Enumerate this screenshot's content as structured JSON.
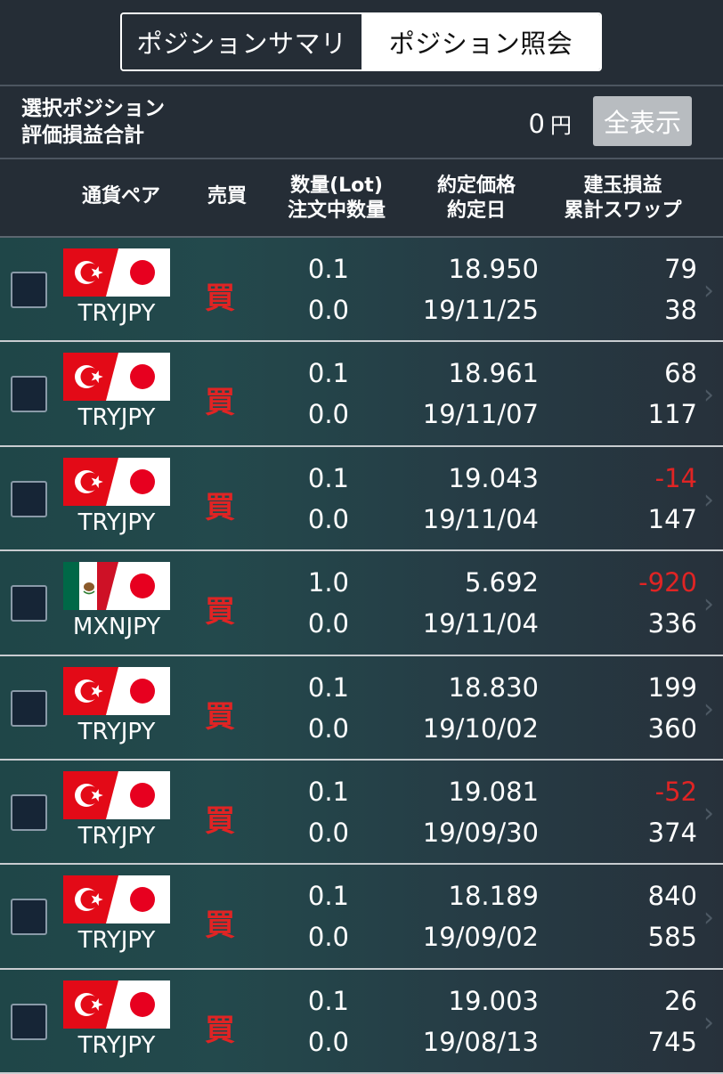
{
  "tabs": [
    {
      "label": "ポジションサマリ",
      "active": false
    },
    {
      "label": "ポジション照会",
      "active": true
    }
  ],
  "summary": {
    "label_line1": "選択ポジション",
    "label_line2": "評価損益合計",
    "value": "0",
    "unit": "円",
    "show_all_label": "全表示"
  },
  "columns": {
    "pair": "通貨ペア",
    "side": "売買",
    "qty_line1": "数量(Lot)",
    "qty_line2": "注文中数量",
    "price_line1": "約定価格",
    "price_line2": "約定日",
    "pl_line1": "建玉損益",
    "pl_line2": "累計スワップ"
  },
  "colors": {
    "negative": "#e02424",
    "side": "#e02424"
  },
  "positions": [
    {
      "pair": "TRYJPY",
      "flag": "turkey",
      "side": "買",
      "qty": "0.1",
      "order_qty": "0.0",
      "price": "18.950",
      "date": "19/11/25",
      "pl": "79",
      "pl_negative": false,
      "swap": "38"
    },
    {
      "pair": "TRYJPY",
      "flag": "turkey",
      "side": "買",
      "qty": "0.1",
      "order_qty": "0.0",
      "price": "18.961",
      "date": "19/11/07",
      "pl": "68",
      "pl_negative": false,
      "swap": "117"
    },
    {
      "pair": "TRYJPY",
      "flag": "turkey",
      "side": "買",
      "qty": "0.1",
      "order_qty": "0.0",
      "price": "19.043",
      "date": "19/11/04",
      "pl": "-14",
      "pl_negative": true,
      "swap": "147"
    },
    {
      "pair": "MXNJPY",
      "flag": "mexico",
      "side": "買",
      "qty": "1.0",
      "order_qty": "0.0",
      "price": "5.692",
      "date": "19/11/04",
      "pl": "-920",
      "pl_negative": true,
      "swap": "336"
    },
    {
      "pair": "TRYJPY",
      "flag": "turkey",
      "side": "買",
      "qty": "0.1",
      "order_qty": "0.0",
      "price": "18.830",
      "date": "19/10/02",
      "pl": "199",
      "pl_negative": false,
      "swap": "360"
    },
    {
      "pair": "TRYJPY",
      "flag": "turkey",
      "side": "買",
      "qty": "0.1",
      "order_qty": "0.0",
      "price": "19.081",
      "date": "19/09/30",
      "pl": "-52",
      "pl_negative": true,
      "swap": "374"
    },
    {
      "pair": "TRYJPY",
      "flag": "turkey",
      "side": "買",
      "qty": "0.1",
      "order_qty": "0.0",
      "price": "18.189",
      "date": "19/09/02",
      "pl": "840",
      "pl_negative": false,
      "swap": "585"
    },
    {
      "pair": "TRYJPY",
      "flag": "turkey",
      "side": "買",
      "qty": "0.1",
      "order_qty": "0.0",
      "price": "19.003",
      "date": "19/08/13",
      "pl": "26",
      "pl_negative": false,
      "swap": "745"
    }
  ]
}
